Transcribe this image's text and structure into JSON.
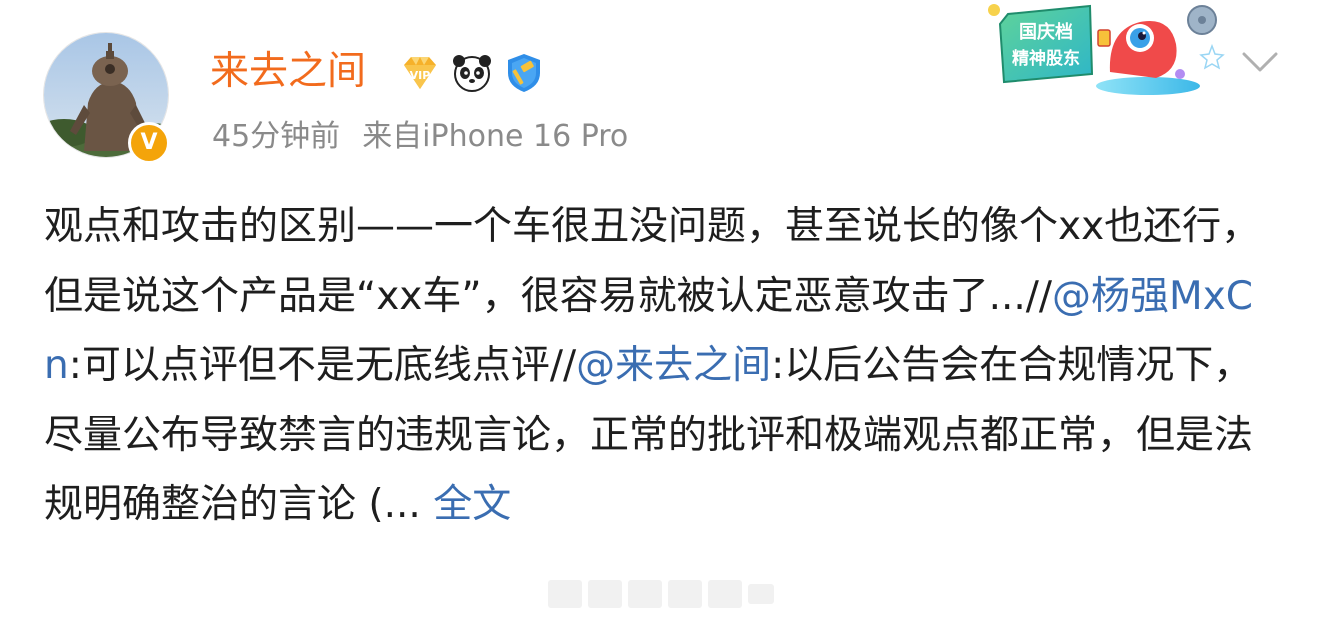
{
  "user": {
    "name": "来去之间",
    "avatar_badge": "V"
  },
  "meta": {
    "time": "45分钟前",
    "source": "来自iPhone 16 Pro"
  },
  "sticker": {
    "line1": "国庆档",
    "line2": "精神股东"
  },
  "post": {
    "seg1": "观点和攻击的区别——一个车很丑没问题，甚至说长的像个xx也还行，但是说这个产品是“xx车”，很容易就被认定恶意攻击了...//",
    "mention1": "@杨强MxCn",
    "seg2": ":可以点评但不是无底线点评//",
    "mention2": "@来去之间",
    "seg3": ":以后公告会在合规情况下，尽量公布导致禁言的违规言论，正常的批评和极端观点都正常，但是法规明确整治的言论 (... ",
    "full_text_link": "全文"
  },
  "colors": {
    "username": "#f26b1d",
    "link": "#3a6db1",
    "meta": "#8a8a8a",
    "text": "#1e1e1e"
  },
  "icons": [
    "vip-diamond-icon",
    "panda-icon",
    "blue-shield-verified-icon",
    "chevron-down-icon"
  ]
}
